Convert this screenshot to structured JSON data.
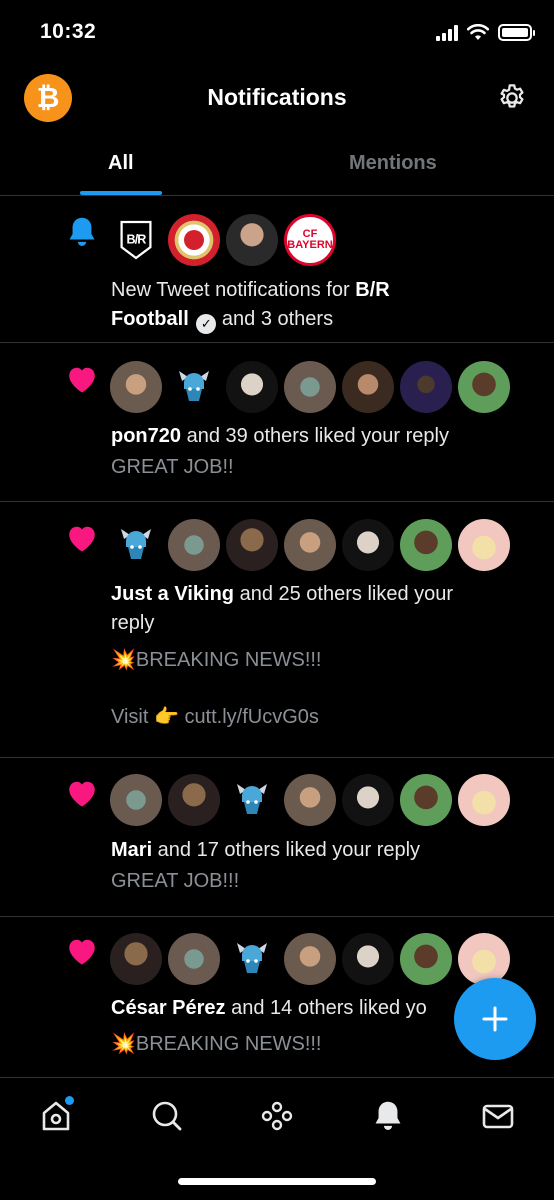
{
  "status_bar": {
    "time": "10:32"
  },
  "header": {
    "title": "Notifications"
  },
  "tabs": [
    {
      "label": "All"
    },
    {
      "label": "Mentions"
    }
  ],
  "notifications": [
    {
      "type": "new-tweet",
      "line1_prefix": "New Tweet notifications for ",
      "line1_bold": "B/R",
      "line2_bold": "Football",
      "line2_suffix": "and 3 others",
      "avatar_labels": [
        "B/R",
        "CF BAYERN"
      ]
    },
    {
      "type": "like",
      "actor": "pon720",
      "text": " and 39 others liked your reply",
      "subtext": "GREAT JOB!!"
    },
    {
      "type": "like",
      "actor": "Just a Viking",
      "text": " and 25 others liked your",
      "text_line2": "reply",
      "subtext": "💥BREAKING NEWS!!!",
      "subtext2": "Visit 👉 cutt.ly/fUcvG0s"
    },
    {
      "type": "like",
      "actor": "Mari",
      "text": " and 17 others liked your reply",
      "subtext": "GREAT JOB!!!"
    },
    {
      "type": "like",
      "actor": "César Pérez",
      "text": " and 14 others liked yo",
      "subtext": "💥BREAKING NEWS!!!"
    }
  ],
  "colors": {
    "accent": "#1d9bf0",
    "like": "#f91880",
    "bitcoin": "#f7931a"
  },
  "icons": [
    "bitcoin-icon",
    "gear-icon",
    "bell-icon",
    "heart-icon",
    "verified-icon",
    "compose-icon",
    "home-icon",
    "search-icon",
    "spaces-icon",
    "notifications-icon",
    "messages-icon"
  ]
}
